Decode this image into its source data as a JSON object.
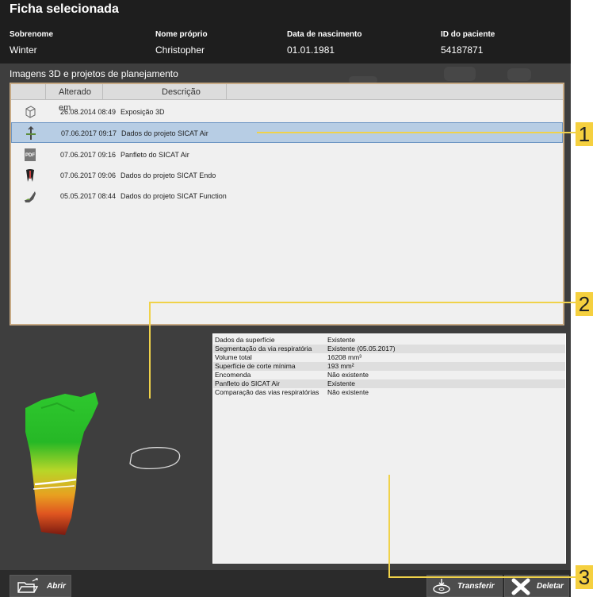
{
  "header": {
    "title": "Ficha selecionada",
    "fields": [
      {
        "label": "Sobrenome",
        "value": "Winter"
      },
      {
        "label": "Nome próprio",
        "value": "Christopher"
      },
      {
        "label": "Data de nascimento",
        "value": "01.01.1981"
      },
      {
        "label": "ID do paciente",
        "value": "54187871"
      }
    ]
  },
  "section_title": "Imagens 3D e projetos de planejamento",
  "list": {
    "columns": [
      "Alterado em",
      "Descrição"
    ],
    "rows": [
      {
        "icon": "cube-icon",
        "date": "26.08.2014 08:49",
        "description": "Exposição 3D",
        "selected": false
      },
      {
        "icon": "airway-icon",
        "date": "07.06.2017 09:17",
        "description": "Dados do projeto SICAT Air",
        "selected": true
      },
      {
        "icon": "pdf-icon",
        "date": "07.06.2017 09:16",
        "description": "Panfleto do SICAT Air",
        "selected": false
      },
      {
        "icon": "tooth-icon",
        "date": "07.06.2017 09:06",
        "description": "Dados do projeto SICAT Endo",
        "selected": false
      },
      {
        "icon": "jaw-icon",
        "date": "05.05.2017 08:44",
        "description": "Dados do projeto SICAT Function",
        "selected": false
      }
    ],
    "pdf_icon_text": "PDF"
  },
  "properties": [
    {
      "key": "Dados da superfície",
      "value": "Existente"
    },
    {
      "key": "Segmentação da via respiratória",
      "value": "Existente (05.05.2017)"
    },
    {
      "key": "Volume total",
      "value": "16208 mm³"
    },
    {
      "key": "Superfície de corte mínima",
      "value": "193 mm²"
    },
    {
      "key": "Encomenda",
      "value": "Não existente"
    },
    {
      "key": "Panfleto do SICAT Air",
      "value": "Existente"
    },
    {
      "key": "Comparação das vias respiratórias",
      "value": "Não existente"
    }
  ],
  "toolbar": {
    "open_label": "Abrir",
    "transfer_label": "Transferir",
    "delete_label": "Deletar"
  },
  "callouts": [
    "1",
    "2",
    "3"
  ],
  "colors": {
    "header_bg": "#1e1e1e",
    "panel_bg": "#f0f0f0",
    "selection": "#b7cde4",
    "panel_border": "#c6a984",
    "callout": "#f5d03f"
  }
}
